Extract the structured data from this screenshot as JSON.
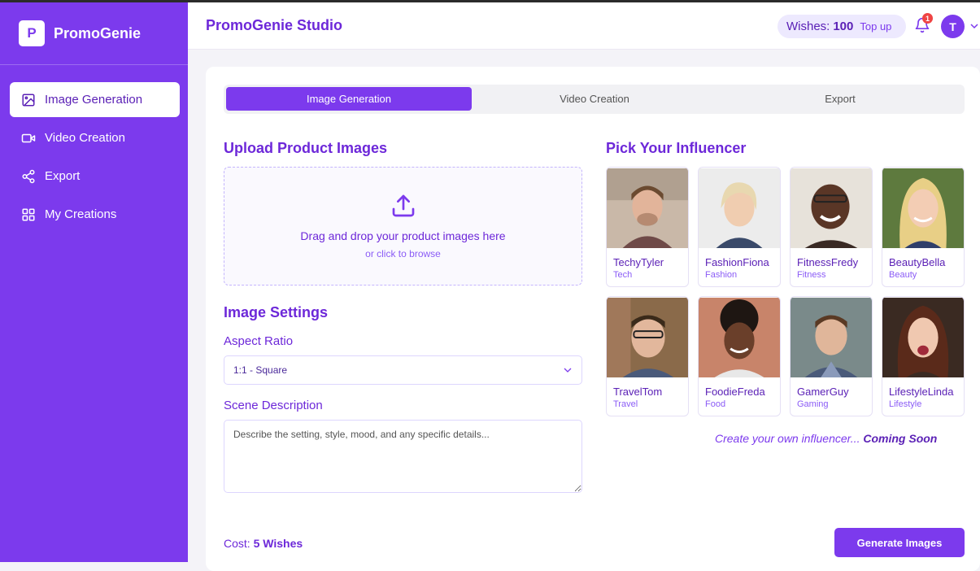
{
  "sidebar": {
    "brand_logo_letter": "P",
    "brand_name": "PromoGenie",
    "items": [
      {
        "label": "Image Generation",
        "icon": "image-icon"
      },
      {
        "label": "Video Creation",
        "icon": "video-icon"
      },
      {
        "label": "Export",
        "icon": "share-icon"
      },
      {
        "label": "My Creations",
        "icon": "grid-icon"
      }
    ]
  },
  "header": {
    "title": "PromoGenie Studio",
    "wishes_label": "Wishes:",
    "wishes_count": "100",
    "topup_label": "Top up",
    "notification_count": "1",
    "avatar_letter": "T"
  },
  "tabs": [
    "Image Generation",
    "Video Creation",
    "Export"
  ],
  "upload": {
    "title": "Upload Product Images",
    "main_text": "Drag and drop your product images here",
    "sub_text": "or click to browse"
  },
  "settings": {
    "title": "Image Settings",
    "aspect_label": "Aspect Ratio",
    "aspect_value": "1:1 - Square",
    "scene_label": "Scene Description",
    "scene_placeholder": "Describe the setting, style, mood, and any specific details..."
  },
  "influencers": {
    "title": "Pick Your Influencer",
    "items": [
      {
        "name": "TechyTyler",
        "category": "Tech"
      },
      {
        "name": "FashionFiona",
        "category": "Fashion"
      },
      {
        "name": "FitnessFredy",
        "category": "Fitness"
      },
      {
        "name": "BeautyBella",
        "category": "Beauty"
      },
      {
        "name": "TravelTom",
        "category": "Travel"
      },
      {
        "name": "FoodieFreda",
        "category": "Food"
      },
      {
        "name": "GamerGuy",
        "category": "Gaming"
      },
      {
        "name": "LifestyleLinda",
        "category": "Lifestyle"
      }
    ],
    "create_own": "Create your own influencer...",
    "coming_soon": "Coming Soon"
  },
  "footer": {
    "cost_label": "Cost:",
    "cost_value": "5 Wishes",
    "generate_label": "Generate Images"
  },
  "colors": {
    "primary": "#7c3aed",
    "primary_dark": "#5b21b6",
    "badge": "#ef4444"
  }
}
